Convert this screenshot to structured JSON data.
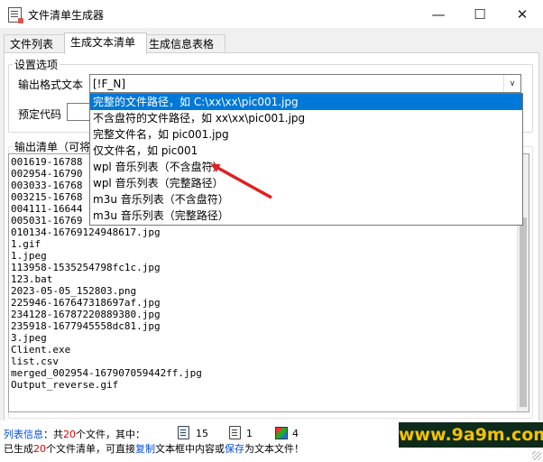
{
  "window": {
    "title": "文件清单生成器",
    "min_glyph": "—",
    "max_glyph": "☐",
    "close_glyph": "✕"
  },
  "tabs": [
    {
      "label": "文件列表",
      "active": false
    },
    {
      "label": "生成文本清单",
      "active": true
    },
    {
      "label": "生成信息表格",
      "active": false
    }
  ],
  "settings": {
    "group_title": "设置选项",
    "format_label": "输出格式文本",
    "format_value": "[!F_N]",
    "preset_label": "预定代码",
    "preset_value": ""
  },
  "dropdown_options": [
    {
      "label": "完整的文件路径，如 C:\\xx\\xx\\pic001.jpg",
      "selected": true
    },
    {
      "label": "不含盘符的文件路径，如 xx\\xx\\pic001.jpg",
      "selected": false
    },
    {
      "label": "完整文件名，如 pic001.jpg",
      "selected": false
    },
    {
      "label": "仅文件名，如 pic001",
      "selected": false
    },
    {
      "label": "wpl 音乐列表（不含盘符）",
      "selected": false
    },
    {
      "label": "wpl 音乐列表（完整路径）",
      "selected": false
    },
    {
      "label": "m3u 音乐列表（不含盘符）",
      "selected": false
    },
    {
      "label": "m3u 音乐列表（完整路径）",
      "selected": false
    }
  ],
  "output": {
    "label": "输出清单（可将",
    "lines": [
      "001619-16788",
      "002954-16790",
      "003033-16768",
      "003215-16768",
      "004111-16644",
      "005031-16769",
      "010134-16769124948617.jpg",
      "1.gif",
      "1.jpeg",
      "113958-1535254798fc1c.jpg",
      "123.bat",
      "2023-05-05_152803.png",
      "225946-167647318697af.jpg",
      "234128-16787220889380.jpg",
      "235918-1677945558dc81.jpg",
      "3.jpeg",
      "Client.exe",
      "list.csv",
      "merged_002954-167907059442ff.jpg",
      "Output_reverse.gif"
    ]
  },
  "status": {
    "list_info_label": "列表信息",
    "total_prefix": "：共",
    "total_count": "20",
    "total_suffix": "个文件，其中：",
    "type_counts": [
      {
        "icon": "image-file-icon",
        "count": "15"
      },
      {
        "icon": "text-file-icon",
        "count": "1"
      },
      {
        "icon": "program-file-icon",
        "count": "4"
      }
    ],
    "line2_prefix": "已生成",
    "line2_count": "20",
    "line2_mid": "个文件清单，可直接",
    "copy_link": "复制",
    "line2_mid2": "文本框中内容或",
    "save_link": "保存",
    "line2_suffix": "为文本文件！"
  },
  "watermark": {
    "text": "www.9a9m.com",
    "bg": "#0e2a1a",
    "fg": "#f2c200"
  },
  "colors": {
    "selection": "#0078d7",
    "link": "#0050e0",
    "count": "#e00000",
    "arrow": "#e02020"
  }
}
